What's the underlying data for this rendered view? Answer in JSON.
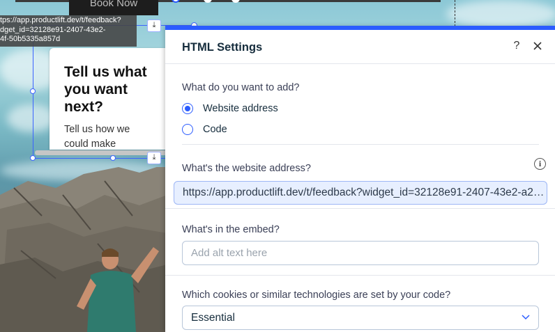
{
  "canvas": {
    "book_button": "Book Now",
    "url_tooltip": "tps://app.productlift.dev/t/feedback?\ndget_id=32128e91-2407-43e2-\n4f-50b5335a857d",
    "embed": {
      "title": "Tell us what you want next?",
      "subtitle": "Tell us how we could make"
    }
  },
  "panel": {
    "title": "HTML Settings",
    "help": "?",
    "add_question": "What do you want to add?",
    "options": [
      {
        "label": "Website address",
        "checked": true
      },
      {
        "label": "Code",
        "checked": false
      }
    ],
    "website_label": "What's the website address?",
    "website_value": "https://app.productlift.dev/t/feedback?widget_id=32128e91-2407-43e2-a24f-50b5335a857d",
    "embed_label": "What's in the embed?",
    "embed_placeholder": "Add alt text here",
    "cookies_label": "Which cookies or similar technologies are set by your code?",
    "cookies_value": "Essential"
  },
  "colors": {
    "accent": "#2b5cff",
    "url_field_bg": "#e7efff"
  }
}
